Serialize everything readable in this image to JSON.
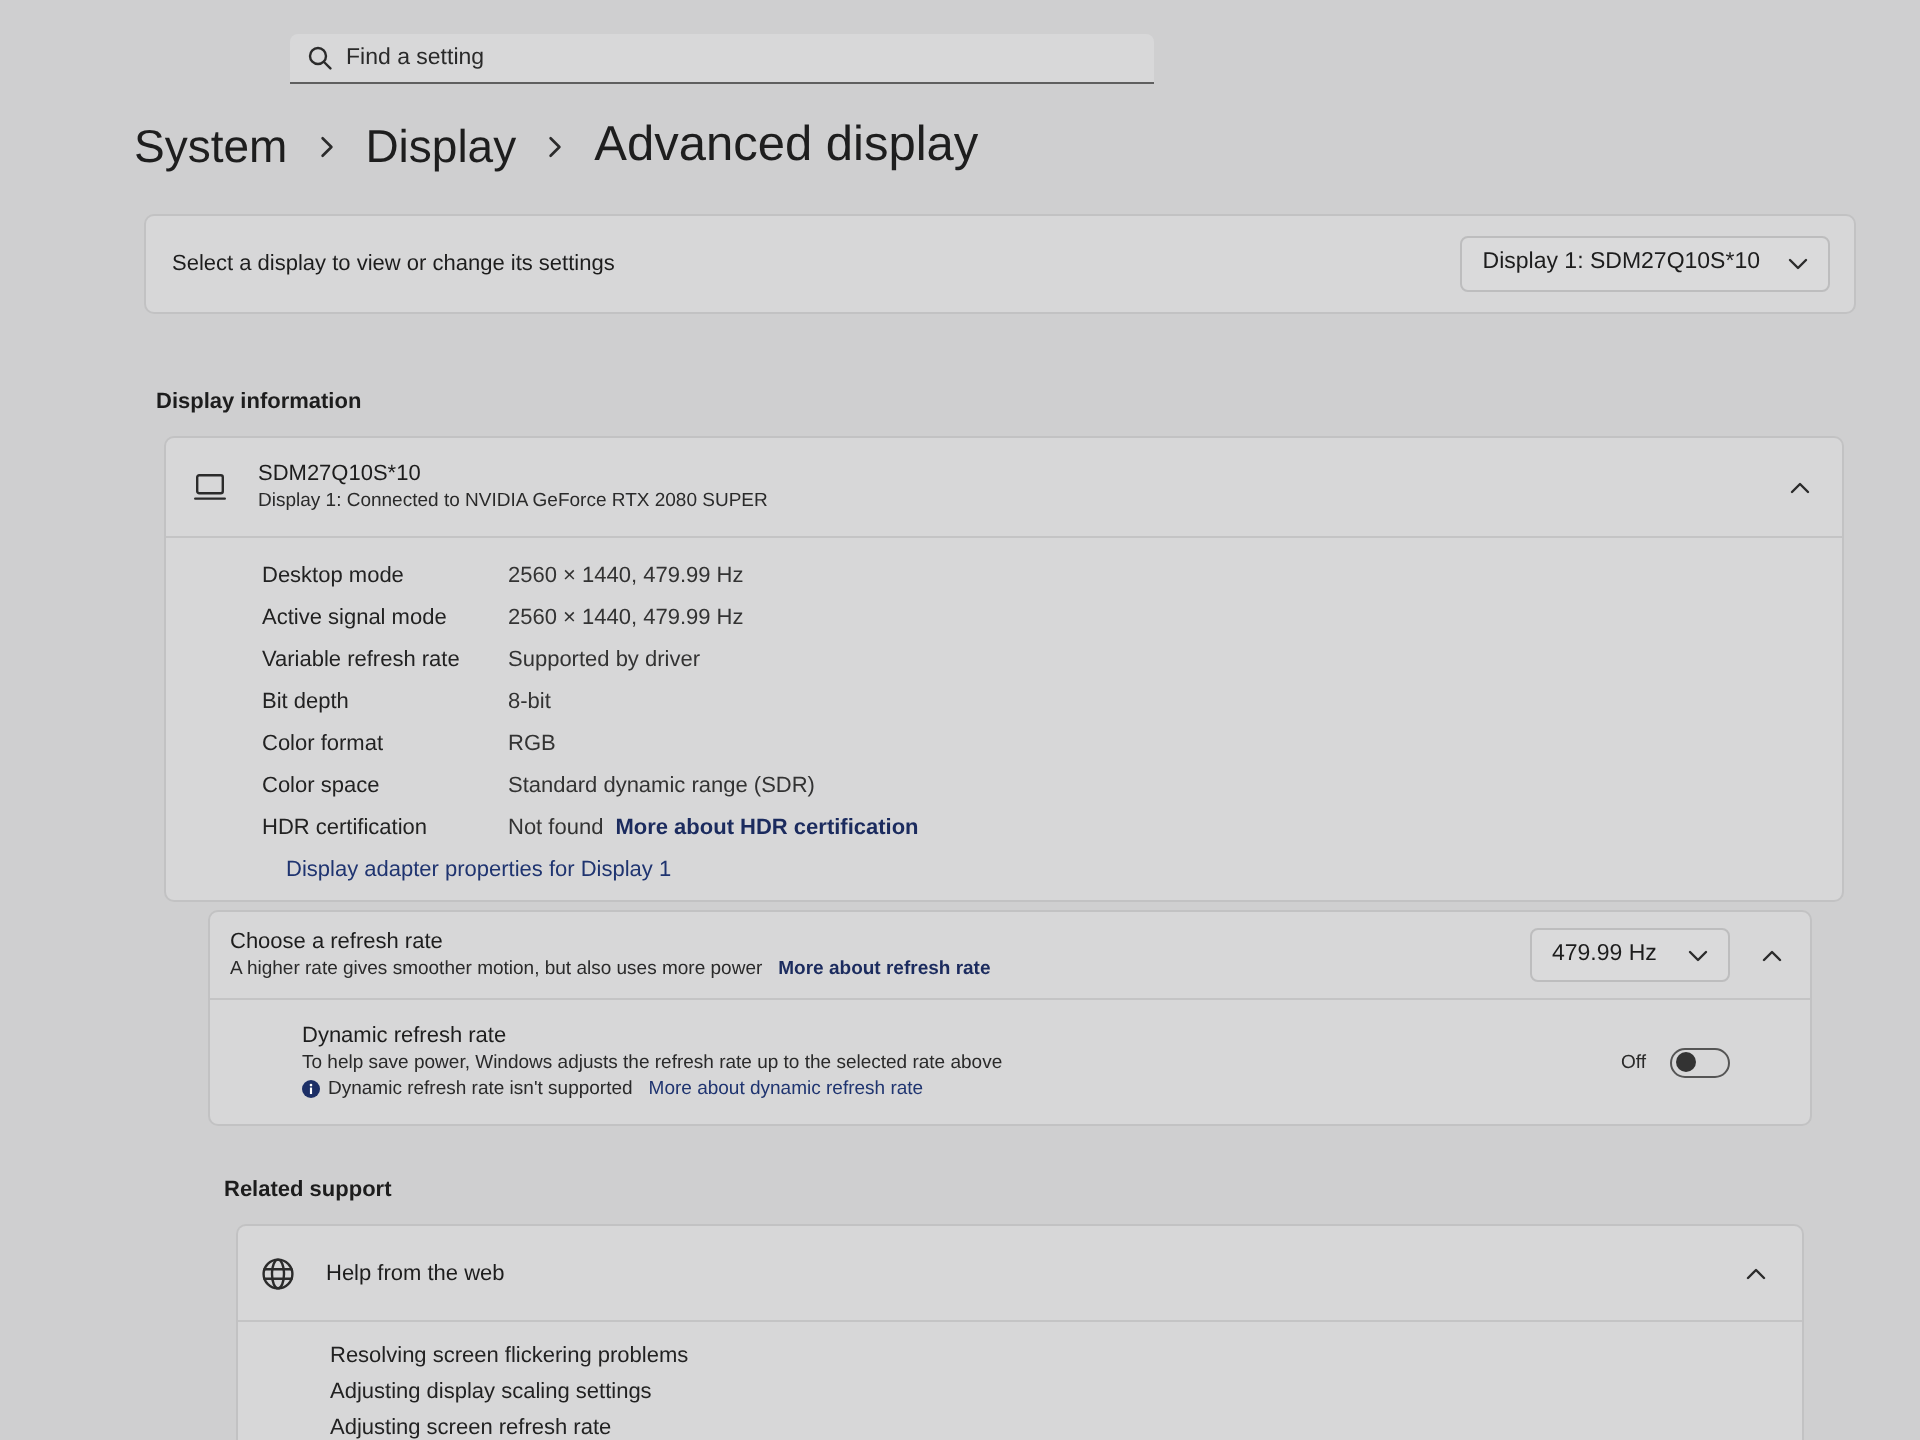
{
  "search": {
    "placeholder": "Find a setting"
  },
  "breadcrumb": [
    {
      "label": "System"
    },
    {
      "label": "Display"
    },
    {
      "label": "Advanced display"
    }
  ],
  "display_select": {
    "label": "Select a display to view or change its settings",
    "value": "Display 1: SDM27Q10S*10"
  },
  "display_information": {
    "heading": "Display information",
    "title": "SDM27Q10S*10",
    "subtitle": "Display 1: Connected to NVIDIA GeForce RTX 2080 SUPER",
    "expanded": true,
    "rows": [
      {
        "label": "Desktop mode",
        "value": "2560 × 1440, 479.99 Hz"
      },
      {
        "label": "Active signal mode",
        "value": "2560 × 1440, 479.99 Hz"
      },
      {
        "label": "Variable refresh rate",
        "value": "Supported by driver"
      },
      {
        "label": "Bit depth",
        "value": "8-bit"
      },
      {
        "label": "Color format",
        "value": "RGB"
      },
      {
        "label": "Color space",
        "value": "Standard dynamic range (SDR)"
      },
      {
        "label": "HDR certification",
        "value": "Not found",
        "link": "More about HDR certification"
      }
    ],
    "adapter_link": "Display adapter properties for Display 1"
  },
  "refresh_rate": {
    "title": "Choose a refresh rate",
    "description": "A higher rate gives smoother motion, but also uses more power",
    "link": "More about refresh rate",
    "value": "479.99 Hz",
    "expanded": true,
    "dynamic": {
      "title": "Dynamic refresh rate",
      "description": "To help save power, Windows adjusts the refresh rate up to the selected rate above",
      "notice": "Dynamic refresh rate isn't supported",
      "notice_link": "More about dynamic refresh rate",
      "state_label": "Off",
      "on": false
    }
  },
  "related_support": {
    "heading": "Related support",
    "title": "Help from the web",
    "expanded": true,
    "links": [
      "Resolving screen flickering problems",
      "Adjusting display scaling settings",
      "Adjusting screen refresh rate"
    ]
  }
}
